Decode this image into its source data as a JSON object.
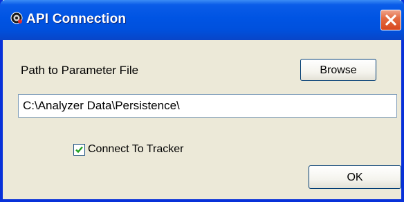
{
  "window": {
    "title": "API Connection",
    "icons": {
      "app": "app-icon",
      "close": "close-icon"
    },
    "colors": {
      "titlebar": "#0054e3",
      "body": "#ece9d8",
      "close": "#d8481f",
      "check": "#21a121"
    }
  },
  "form": {
    "path_label": "Path to Parameter File",
    "browse_label": "Browse",
    "path_value": "C:\\Analyzer Data\\Persistence\\",
    "tracker_label": "Connect To Tracker",
    "tracker_checked": true,
    "ok_label": "OK"
  }
}
